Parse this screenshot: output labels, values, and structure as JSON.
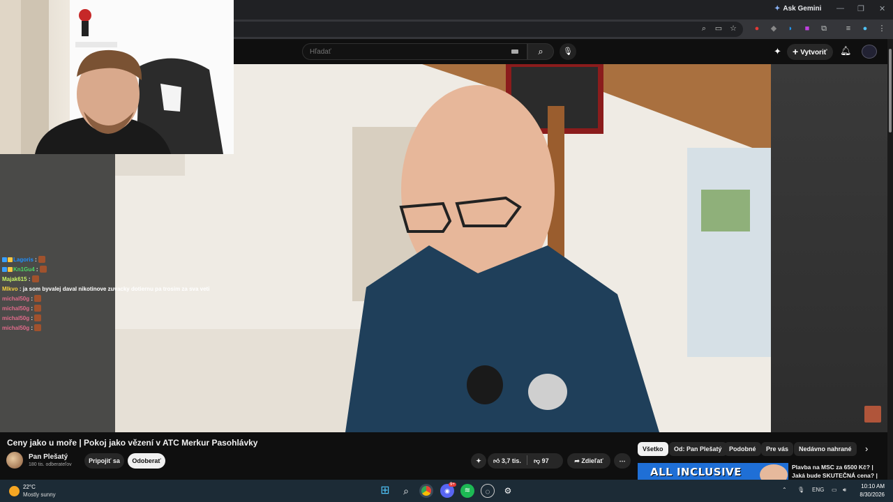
{
  "browser": {
    "ask_gemini": "Ask Gemini",
    "window_controls": [
      "—",
      "❐",
      "✕"
    ]
  },
  "youtube": {
    "search_placeholder": "Hľadať",
    "create_label": "Vytvoriť"
  },
  "chat": [
    {
      "user": "Lagoris",
      "msg": "",
      "color": "#1e90ff",
      "emote": true,
      "badges": 2
    },
    {
      "user": "Kn1Gu4",
      "msg": "",
      "color": "#4cd964",
      "emote": true,
      "badges": 2
    },
    {
      "user": "Majak615",
      "msg": "",
      "color": "#c7f464",
      "emote": true,
      "badges": 0
    },
    {
      "user": "Mlkvo",
      "msg": "ja som byvalej daval nikotinove zuvacky dotiernu pa trosim za sva veti",
      "color": "#f4d03f",
      "emote": false,
      "badges": 0
    },
    {
      "user": "michal50g",
      "msg": "",
      "color": "#e06b8b",
      "emote": true,
      "badges": 0
    },
    {
      "user": "michal50g",
      "msg": "",
      "color": "#e06b8b",
      "emote": true,
      "badges": 0
    },
    {
      "user": "michal50g",
      "msg": "",
      "color": "#e06b8b",
      "emote": true,
      "badges": 0
    },
    {
      "user": "michal50g",
      "msg": "",
      "color": "#e06b8b",
      "emote": true,
      "badges": 0
    }
  ],
  "video": {
    "title": "Ceny jako u moře | Pokoj jako vězení v ATC Merkur Pasohlávky",
    "channel": "Pan Plešatý",
    "subscribers": "180 tis. odberateľov",
    "join_label": "Pripojiť sa",
    "unsubscribe_label": "Odoberať",
    "likes": "3,7 tis.",
    "dislikes": "97",
    "share_label": "Zdieľať"
  },
  "chips": [
    "Všetko",
    "Od: Pan Plešatý",
    "Podobné",
    "Pre vás",
    "Nedávno nahrané"
  ],
  "recommendation": {
    "thumb_text": "ALL INCLUSIVE",
    "title_line1": "Plavba na MSC za 6500 Kč? |",
    "title_line2": "Jaká bude SKUTEČNÁ cena? |"
  },
  "taskbar": {
    "temp": "22°C",
    "weather": "Mostly sunny",
    "lang": "ENG",
    "time": "10:10 AM",
    "date": "8/30/2026",
    "discord_badge": "9+"
  }
}
